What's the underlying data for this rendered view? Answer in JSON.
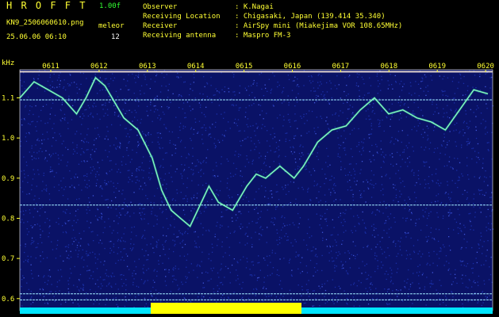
{
  "app": {
    "title": "H R O F F T",
    "version": "1.00f",
    "filename": "KN9_2506060610.png",
    "mode": "meleor",
    "datetime": "25.06.06 06:10",
    "count": "12"
  },
  "info": {
    "observer_label": "Observer",
    "observer_value": ": K.Nagai",
    "location_label": "Receiving Location",
    "location_value": ": Chigasaki, Japan (139.414 35.340)",
    "receiver_label": "Receiver",
    "receiver_value": ": AirSpy mini (Miakejima VOR 108.65MHz)",
    "antenna_label": "Receiving antenna",
    "antenna_value": ": Maspro FM-3"
  },
  "axes": {
    "y_unit": "kHz",
    "y_ticks": [
      "1.1",
      "1.0",
      "0.9",
      "0.8",
      "0.7",
      "0.6"
    ],
    "y_range": [
      0.57,
      1.17
    ],
    "x_ticks": [
      "0611",
      "0612",
      "0613",
      "0614",
      "0615",
      "0616",
      "0617",
      "0618",
      "0619",
      "0620"
    ],
    "x_range": [
      0,
      10
    ]
  },
  "chart_data": {
    "type": "line",
    "xlabel": "",
    "ylabel": "kHz",
    "x_labels": [
      "0611",
      "0612",
      "0613",
      "0614",
      "0615",
      "0616",
      "0617",
      "0618",
      "0619",
      "0620"
    ],
    "ylim": [
      0.57,
      1.17
    ],
    "series": [
      {
        "x": [
          0.0,
          0.3,
          0.6,
          0.9,
          1.2,
          1.4,
          1.6,
          1.8,
          2.0,
          2.2,
          2.5,
          2.8,
          3.0,
          3.2,
          3.4,
          3.6,
          3.8,
          4.0,
          4.2,
          4.5,
          4.8,
          5.0,
          5.2,
          5.5,
          5.8,
          6.0,
          6.3,
          6.6,
          6.9,
          7.2,
          7.5,
          7.8,
          8.1,
          8.4,
          8.7,
          9.0,
          9.3,
          9.6,
          9.9
        ],
        "y": [
          1.1,
          1.14,
          1.12,
          1.1,
          1.06,
          1.1,
          1.15,
          1.13,
          1.09,
          1.05,
          1.02,
          0.95,
          0.87,
          0.82,
          0.8,
          0.78,
          0.83,
          0.88,
          0.84,
          0.82,
          0.88,
          0.91,
          0.9,
          0.93,
          0.9,
          0.93,
          0.99,
          1.02,
          1.03,
          1.07,
          1.1,
          1.06,
          1.07,
          1.05,
          1.04,
          1.02,
          1.07,
          1.12,
          1.11
        ]
      }
    ],
    "horizontal_lines": [
      1.165,
      1.095,
      0.833,
      0.612,
      0.597
    ],
    "colors": {
      "line": "#9fffd0",
      "noise": "#1a2fa8",
      "background": "#0a1266",
      "bottom_band": "#00e5ff",
      "bottom_peak": "#ffff00"
    }
  }
}
